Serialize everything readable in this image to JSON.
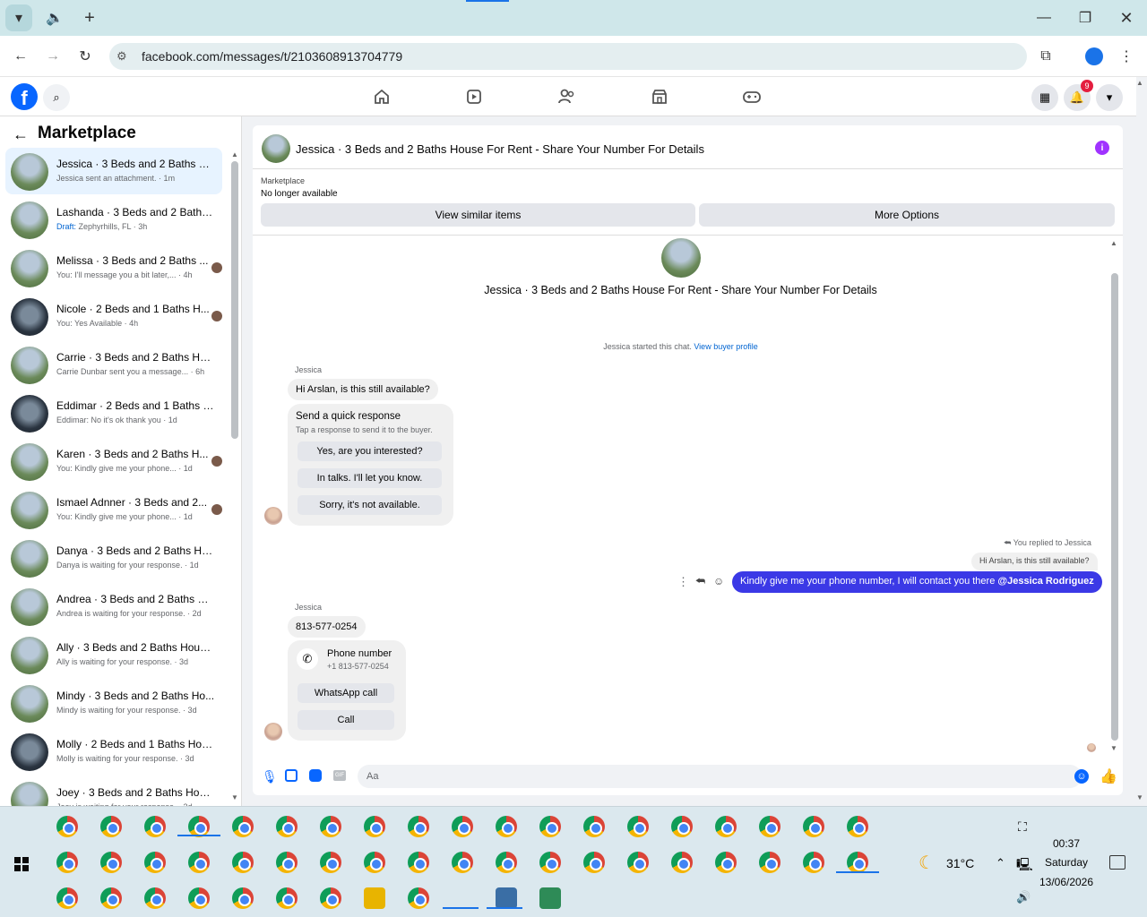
{
  "browser": {
    "url": "facebook.com/messages/t/2103608913704779",
    "notification_count": "9"
  },
  "sidebar": {
    "title": "Marketplace",
    "conversations": [
      {
        "title": "Jessica · 3 Beds and 2 Baths Ho...",
        "sub": "Jessica sent an attachment. · 1m"
      },
      {
        "title": "Lashanda · 3 Beds and 2 Baths ...",
        "draft": "Draft:",
        "sub": " Zephyrhills, FL · 3h"
      },
      {
        "title": "Melissa · 3 Beds and 2 Baths ...",
        "sub": "You: I'll message you a bit later,... · 4h"
      },
      {
        "title": "Nicole · 2 Beds and 1 Baths H...",
        "sub": "You: Yes Available · 4h"
      },
      {
        "title": "Carrie · 3 Beds and 2 Baths Hou...",
        "sub": "Carrie Dunbar sent you a message... · 6h"
      },
      {
        "title": "Eddimar · 2 Beds and 1 Baths H...",
        "sub": "Eddimar: No it's ok thank you · 1d"
      },
      {
        "title": "Karen · 3 Beds and 2 Baths H...",
        "sub": "You: Kindly give me your phone... · 1d"
      },
      {
        "title": "Ismael Adnner · 3 Beds and 2...",
        "sub": "You: Kindly give me your phone... · 1d"
      },
      {
        "title": "Danya · 3 Beds and 2 Baths Ho...",
        "sub": "Danya is waiting for your response. · 1d"
      },
      {
        "title": "Andrea · 3 Beds and 2 Baths Ho...",
        "sub": "Andrea is waiting for your response. · 2d"
      },
      {
        "title": "Ally · 3 Beds and 2 Baths House...",
        "sub": "Ally is waiting for your response. · 3d"
      },
      {
        "title": "Mindy · 3 Beds and 2 Baths Ho...",
        "sub": "Mindy is waiting for your response. · 3d"
      },
      {
        "title": "Molly · 2 Beds and 1 Baths Hou...",
        "sub": "Molly is waiting for your response. · 3d"
      },
      {
        "title": "Joey · 3 Beds and 2 Baths Hous...",
        "sub": "Joey is waiting for your response. · 3d"
      }
    ]
  },
  "chat": {
    "header_title": "Jessica · 3 Beds and 2 Baths House For Rent - Share Your Number For Details",
    "marketplace_label": "Marketplace",
    "availability": "No longer available",
    "view_similar": "View similar items",
    "more_options": "More Options",
    "listing_title": "Jessica · 3 Beds and 2 Baths House For Rent - Share Your Number For Details",
    "started_text": "Jessica started this chat.",
    "view_buyer_profile": "View buyer profile",
    "sender_name": "Jessica",
    "msg_1": "Hi Arslan, is this still available?",
    "quick_title": "Send a quick response",
    "quick_sub": "Tap a response to send it to the buyer.",
    "quick_options": [
      "Yes, are you interested?",
      "In talks. I'll let you know.",
      "Sorry, it's not available."
    ],
    "replied_to": "You replied to Jessica",
    "quoted": "Hi Arslan, is this still available?",
    "my_msg": "Kindly give me your phone number, I will contact you there ",
    "mention": "@Jessica Rodriguez",
    "sender_name_2": "Jessica",
    "phone_msg": "813-577-0254",
    "phone_label": "Phone number",
    "phone_value": "+1 813-577-0254",
    "whatsapp": "WhatsApp call",
    "call": "Call",
    "composer_placeholder": "Aa"
  },
  "taskbar": {
    "weather": "31°C",
    "time": "00:37",
    "day": "Saturday",
    "date": "13/06/2026"
  },
  "colors": {
    "fb_blue": "#0866ff",
    "my_bubble": "#3b39e6",
    "accent": "#1a73e8"
  }
}
